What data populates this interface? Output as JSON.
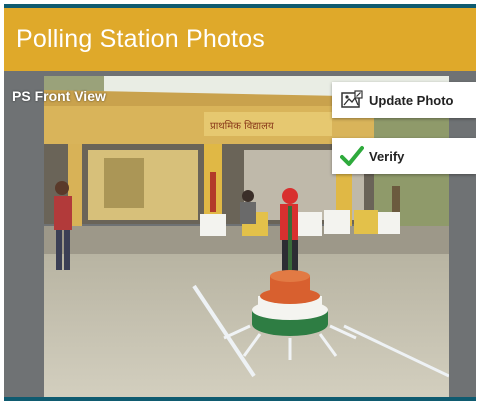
{
  "header": {
    "title": "Polling Station Photos"
  },
  "photo": {
    "label": "PS Front View",
    "sign_text": "प्राथमिक विद्यालय"
  },
  "actions": {
    "update_photo": {
      "label": "Update Photo",
      "icon": "image-edit-icon"
    },
    "verify": {
      "label": "Verify",
      "icon": "checkmark-icon"
    }
  },
  "colors": {
    "header": "#dfa92a",
    "accent_strip": "#0f5b70",
    "check": "#2eaa3c"
  }
}
